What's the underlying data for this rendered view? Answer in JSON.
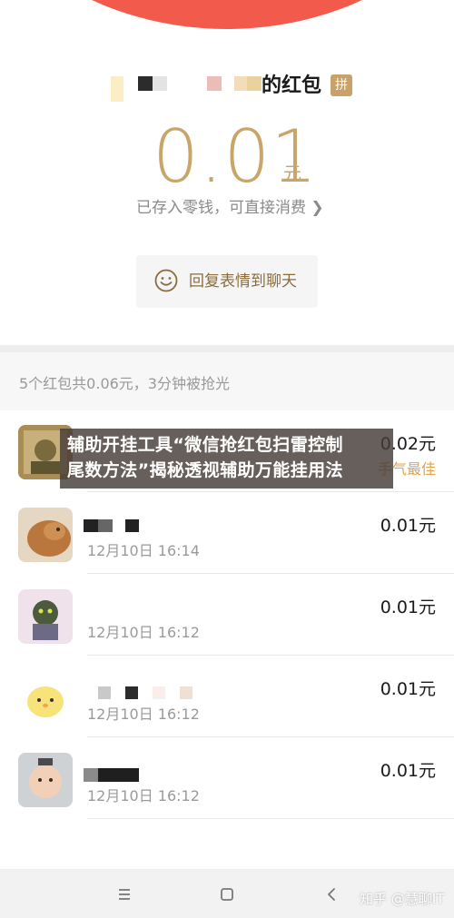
{
  "header": {
    "sender_suffix": "的红包",
    "badge": "拼",
    "amount": "0.01",
    "unit": "元",
    "saved_text": "已存入零钱，可直接消费 ❯",
    "reply_label": "回复表情到聊天",
    "colors": {
      "accent_red": "#f25b4c",
      "gold": "#c9a567"
    }
  },
  "summary": {
    "text": "5个红包共0.06元，3分钟被抢光"
  },
  "overlay": {
    "line1": "辅助开挂工具“微信抢红包扫雷控制",
    "line2": "尾数方法”揭秘透视辅助万能挂用法"
  },
  "list": {
    "items": [
      {
        "amount": "0.02元",
        "time": "",
        "tag": "手气最佳"
      },
      {
        "amount": "0.01元",
        "time": "12月10日 16:14"
      },
      {
        "amount": "0.01元",
        "time": "12月10日 16:12"
      },
      {
        "amount": "0.01元",
        "time": "12月10日 16:12"
      },
      {
        "amount": "0.01元",
        "time": "12月10日 16:12"
      }
    ]
  },
  "nav": {
    "icons": [
      "menu-icon",
      "home-square-icon",
      "back-chevron-icon"
    ]
  },
  "watermark": "知乎 @慧聊IT"
}
